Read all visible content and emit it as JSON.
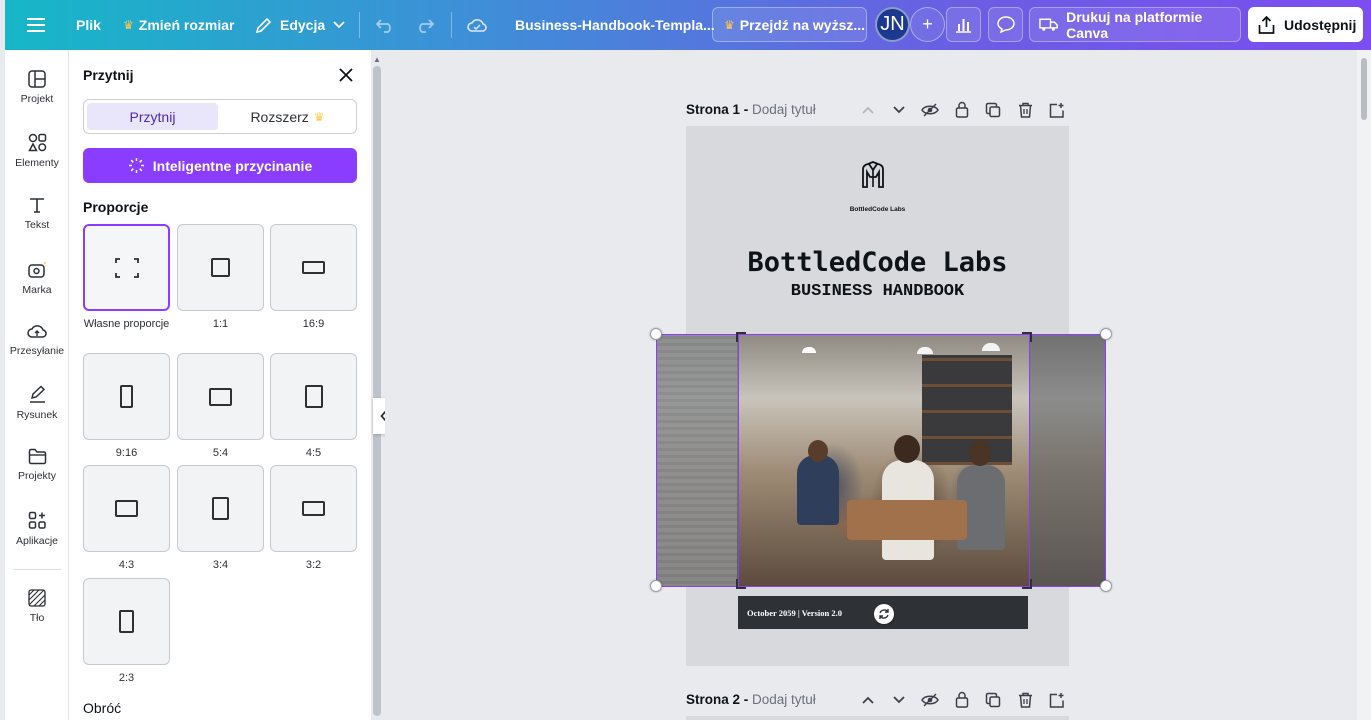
{
  "topbar": {
    "file": "Plik",
    "resize": "Zmień rozmiar",
    "edit": "Edycja",
    "doc_name": "Business-Handbook-Templa...",
    "upgrade": "Przejdź na wyższ...",
    "avatar_initials": "JN",
    "print": "Drukuj na platformie Canva",
    "share": "Udostępnij"
  },
  "rail": {
    "items": [
      {
        "label": "Projekt",
        "icon": "layout-icon"
      },
      {
        "label": "Elementy",
        "icon": "shapes-icon"
      },
      {
        "label": "Tekst",
        "icon": "text-icon"
      },
      {
        "label": "Marka",
        "icon": "brand-icon"
      },
      {
        "label": "Przesyłanie",
        "icon": "upload-cloud-icon"
      },
      {
        "label": "Rysunek",
        "icon": "draw-icon"
      },
      {
        "label": "Projekty",
        "icon": "folder-icon"
      },
      {
        "label": "Aplikacje",
        "icon": "apps-icon"
      },
      {
        "label": "Tło",
        "icon": "background-icon"
      }
    ]
  },
  "panel": {
    "title": "Przytnij",
    "tab_crop": "Przytnij",
    "tab_expand": "Rozszerz",
    "smart_crop": "Inteligentne przycinanie",
    "proportions_label": "Proporcje",
    "ratios": [
      {
        "label": "Własne proporcje"
      },
      {
        "label": "1:1"
      },
      {
        "label": "16:9"
      },
      {
        "label": "9:16"
      },
      {
        "label": "5:4"
      },
      {
        "label": "4:5"
      },
      {
        "label": "4:3"
      },
      {
        "label": "3:4"
      },
      {
        "label": "3:2"
      },
      {
        "label": "2:3"
      }
    ],
    "rotate_label": "Obróć"
  },
  "canvas": {
    "page1_label": "Strona 1 - ",
    "page1_title": "Dodaj tytuł",
    "page2_label": "Strona 2 - ",
    "page2_title": "Dodaj tytuł",
    "logo_text": "BottledCode Labs",
    "doc_title": "BottledCode Labs",
    "doc_subtitle": "BUSINESS HANDBOOK",
    "footer": "October 2059 | Version 2.0"
  },
  "colors": {
    "accent": "#8b3dff",
    "topbar_start": "#16b7c7",
    "topbar_end": "#7c4df0"
  }
}
